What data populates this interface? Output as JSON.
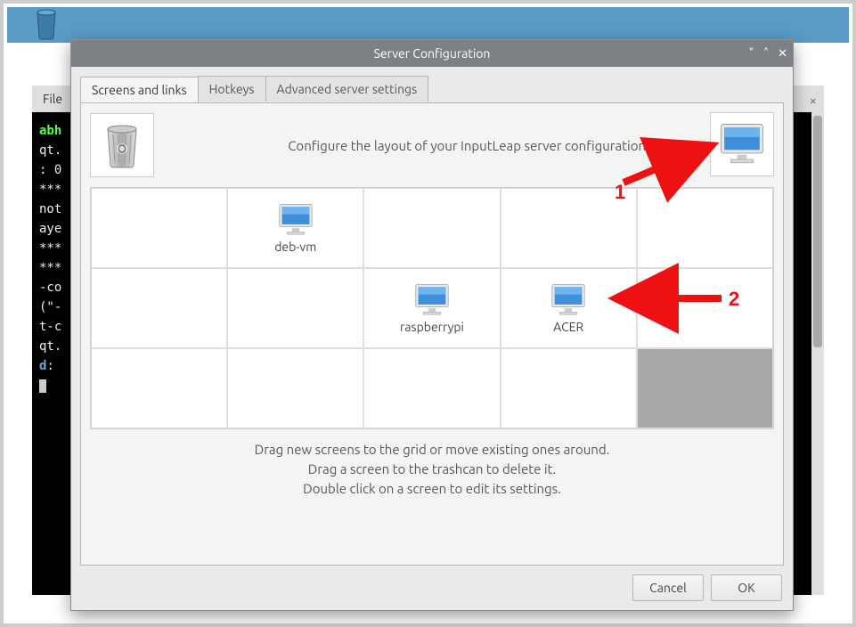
{
  "dialog": {
    "title": "Server Configuration",
    "tabs": {
      "screens": "Screens and links",
      "hotkeys": "Hotkeys",
      "advanced": "Advanced server settings"
    },
    "instruction": "Configure the layout of your InputLeap server configuration.",
    "hints": {
      "l1": "Drag new screens to the grid or move existing ones around.",
      "l2": "Drag a screen to the trashcan to delete it.",
      "l3": "Double click on a screen to edit its settings."
    },
    "screens": {
      "deb": "deb-vm",
      "raspi": "raspberrypi",
      "acer": "ACER"
    },
    "buttons": {
      "cancel": "Cancel",
      "ok": "OK"
    }
  },
  "background": {
    "menubar_file": "File",
    "term_prompt_user": "abh",
    "term_close": "×"
  },
  "annotations": {
    "one": "1",
    "two": "2"
  }
}
